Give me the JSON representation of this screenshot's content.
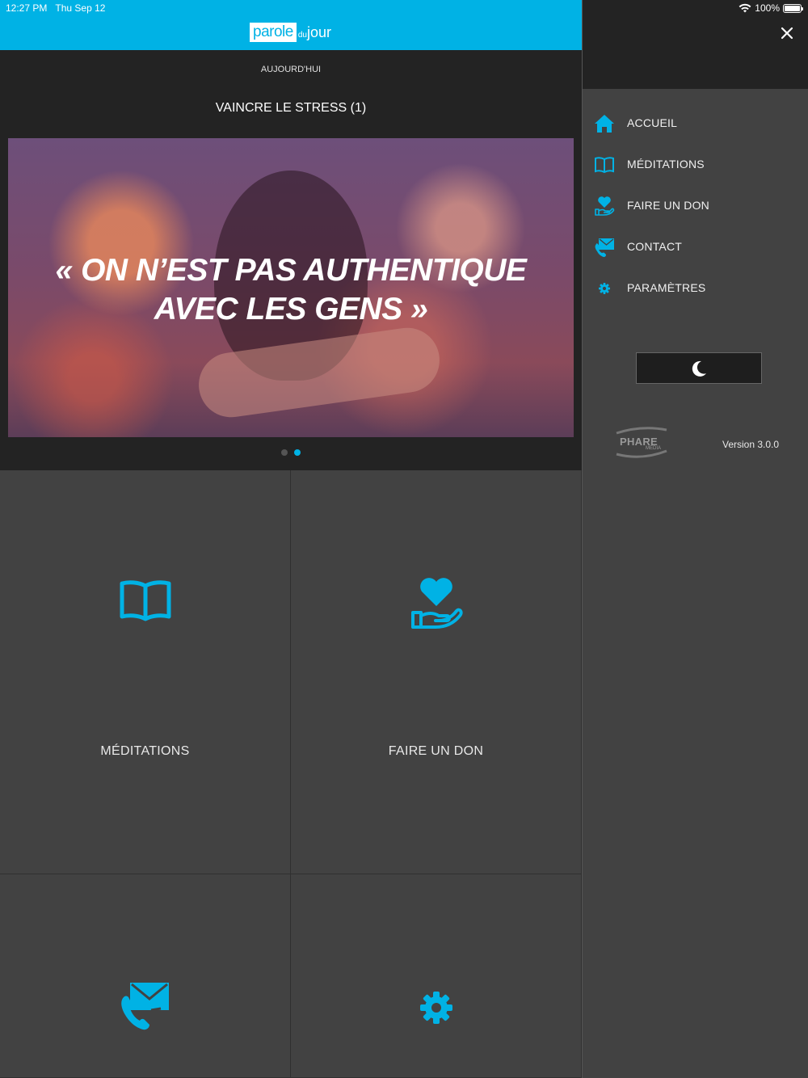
{
  "status": {
    "time": "12:27 PM",
    "date": "Thu Sep 12",
    "battery": "100%",
    "battery_level": 1.0
  },
  "header": {
    "logo_box": "parole",
    "logo_small": "du",
    "logo_rest": "jour"
  },
  "today_label": "AUJOURD'HUI",
  "title": "VAINCRE LE STRESS (1)",
  "hero": {
    "quote_line1": "« ON N’EST PAS AUTHENTIQUE",
    "quote_line2": "AVEC LES GENS »"
  },
  "carousel": {
    "pages": 2,
    "active": 2
  },
  "tiles": [
    {
      "label": "MÉDITATIONS",
      "icon": "book-icon"
    },
    {
      "label": "FAIRE UN DON",
      "icon": "heart-hand-icon"
    },
    {
      "label": "",
      "icon": "phone-mail-icon"
    },
    {
      "label": "",
      "icon": "gear-icon"
    }
  ],
  "drawer": {
    "items": [
      {
        "label": "ACCUEIL",
        "icon": "home-icon"
      },
      {
        "label": "MÉDITATIONS",
        "icon": "book-icon"
      },
      {
        "label": "FAIRE UN DON",
        "icon": "heart-hand-icon"
      },
      {
        "label": "CONTACT",
        "icon": "phone-mail-icon"
      },
      {
        "label": "PARAMÈTRES",
        "icon": "gear-icon"
      }
    ],
    "brand_logo": "PHARE",
    "brand_sub": "MEDIA",
    "version": "Version 3.0.0"
  },
  "colors": {
    "accent": "#00b2e5",
    "dark": "#232323",
    "panel": "#424242"
  }
}
